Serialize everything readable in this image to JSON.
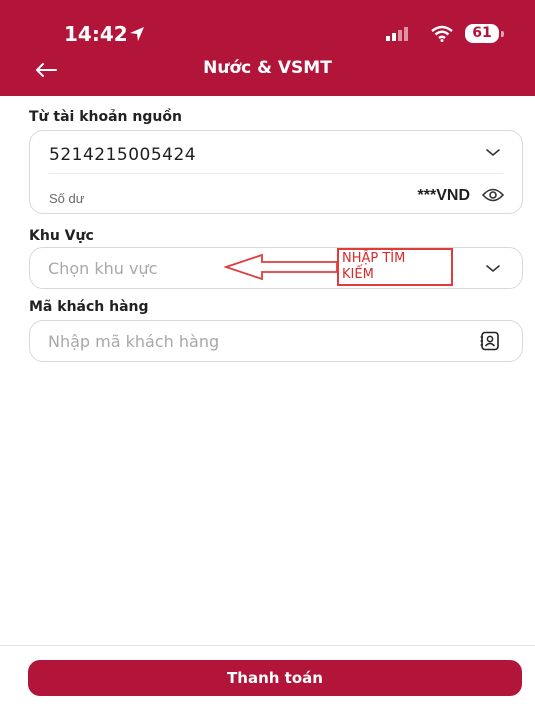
{
  "status_bar": {
    "time": "14:42",
    "battery": "61"
  },
  "header": {
    "title": "Nước & VSMT"
  },
  "source_account": {
    "label": "Từ tài khoản nguồn",
    "account_number": "5214215005424",
    "balance_label": "Số dư",
    "balance_value": "***VND"
  },
  "region": {
    "label": "Khu Vực",
    "placeholder": "Chọn khu vực"
  },
  "annotation": {
    "line1": "NHẬP TÌM",
    "line2": "KIẾM"
  },
  "customer_code": {
    "label": "Mã khách hàng",
    "placeholder": "Nhập mã khách hàng"
  },
  "footer": {
    "pay_label": "Thanh toán"
  },
  "colors": {
    "brand": "#b3143a",
    "annotation": "#e23b3b"
  },
  "icons": [
    "location-arrow-icon",
    "signal-icon",
    "wifi-icon",
    "back-arrow-icon",
    "chevron-down-icon",
    "eye-icon",
    "contacts-icon",
    "annotation-arrow-icon"
  ]
}
